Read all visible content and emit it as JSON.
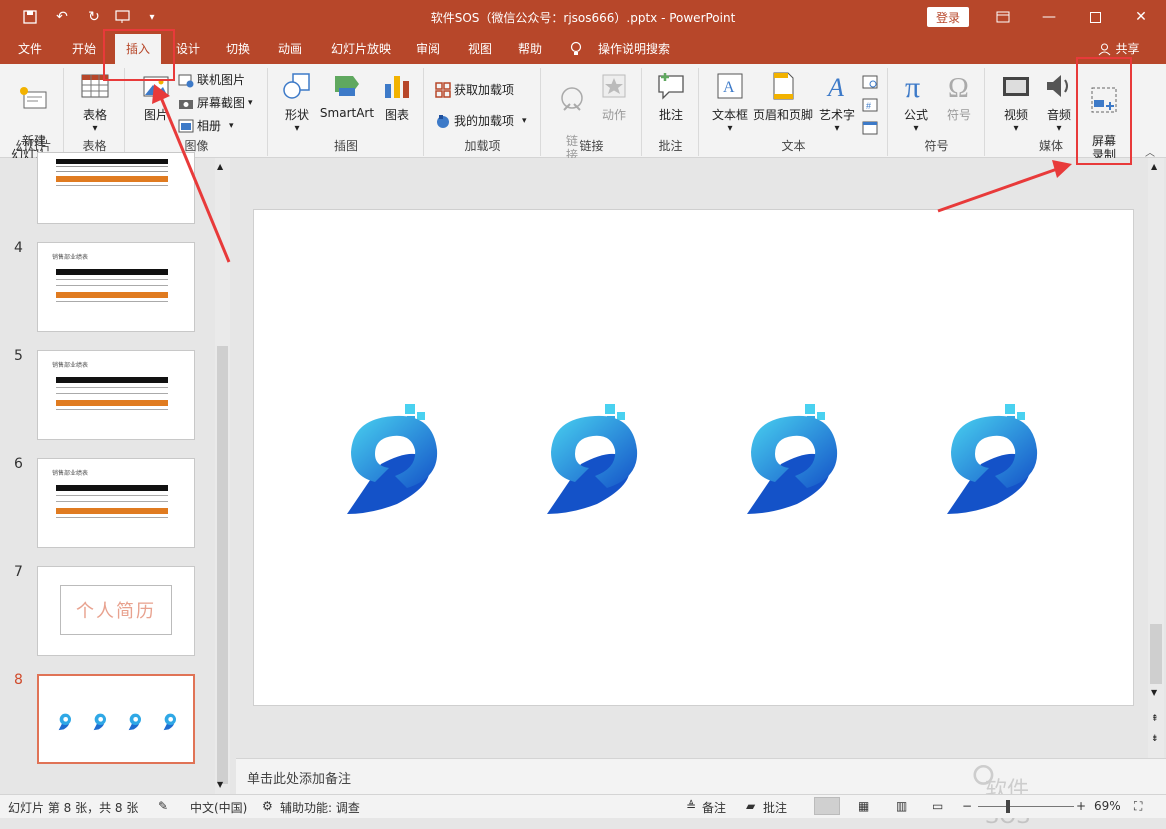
{
  "window": {
    "title": "软件SOS（微信公众号：rjsos666）.pptx  -  PowerPoint",
    "login": "登录",
    "share": "共享"
  },
  "tabs": [
    "文件",
    "开始",
    "插入",
    "设计",
    "切换",
    "动画",
    "幻灯片放映",
    "审阅",
    "视图",
    "帮助",
    "操作说明搜索"
  ],
  "ribbon": {
    "slides": {
      "new_slide": "新建\n幻灯片",
      "label": "幻灯片"
    },
    "tables": {
      "table": "表格",
      "label": "表格"
    },
    "images": {
      "picture": "图片",
      "online_pictures": "联机图片",
      "screenshot": "屏幕截图",
      "album": "相册",
      "label": "图像"
    },
    "illustrations": {
      "shapes": "形状",
      "smartart": "SmartArt",
      "chart": "图表",
      "label": "插图"
    },
    "addins": {
      "get": "获取加载项",
      "mine": "我的加载项",
      "label": "加载项"
    },
    "links": {
      "link": "链\n接",
      "action": "动作",
      "label": "链接"
    },
    "comments": {
      "comment": "批注",
      "label": "批注"
    },
    "text": {
      "textbox": "文本框",
      "header_footer": "页眉和页脚",
      "wordart": "艺术字",
      "label": "文本"
    },
    "symbols": {
      "equation": "公式",
      "symbol": "符号",
      "label": "符号"
    },
    "media": {
      "video": "视频",
      "audio": "音频",
      "screen_recording": "屏幕\n录制",
      "label": "媒体"
    }
  },
  "slides_panel": {
    "thumbs": [
      {
        "num": "",
        "title": ""
      },
      {
        "num": "4",
        "title": "销售部业绩表"
      },
      {
        "num": "5",
        "title": "销售部业绩表"
      },
      {
        "num": "6",
        "title": "销售部业绩表"
      },
      {
        "num": "7",
        "title": "个人简历"
      },
      {
        "num": "8",
        "title": ""
      }
    ]
  },
  "notes_placeholder": "单击此处添加备注",
  "status": {
    "slide_info": "幻灯片 第 8 张，共 8 张",
    "language": "中文(中国)",
    "accessibility": "辅助功能: 调查",
    "notes": "备注",
    "comments": "批注",
    "zoom": "69%"
  },
  "watermark": "软件SOS",
  "colors": {
    "accent": "#b7472a",
    "highlight": "#e83a3a"
  }
}
